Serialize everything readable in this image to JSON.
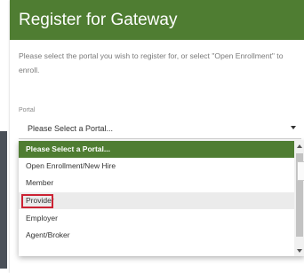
{
  "header": {
    "title": "Register for Gateway",
    "background": "#4f7d32"
  },
  "instructions": "Please select the portal you wish to register for, or select \"Open Enrollment\" to enroll.",
  "portal_field": {
    "label": "Portal",
    "current_value": "Please Select a Portal..."
  },
  "dropdown": {
    "options": [
      {
        "label": "Please Select a Portal..."
      },
      {
        "label": "Open Enrollment/New Hire"
      },
      {
        "label": "Member"
      },
      {
        "label": "Provider"
      },
      {
        "label": "Employer"
      },
      {
        "label": "Agent/Broker"
      }
    ],
    "selected_index": 0,
    "hovered_index": 3,
    "highlight_color": "#cc2233"
  },
  "icons": {
    "select_arrow": "chevron-down-icon",
    "scroll_up": "scroll-up-arrow-icon",
    "scroll_down": "scroll-down-arrow-icon"
  }
}
